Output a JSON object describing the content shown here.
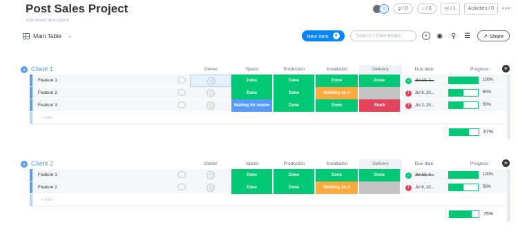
{
  "board": {
    "title": "Post Sales Project",
    "description_placeholder": "Add board description",
    "view_label": "Main Table"
  },
  "header": {
    "activity_counts": [
      "/ 0",
      "/ 0"
    ],
    "members": "/ 1",
    "activities_label": "Activities / 0"
  },
  "toolbar": {
    "new_item_label": "New Item",
    "search_placeholder": "Search / Filter Board",
    "share_label": "Share"
  },
  "columns": [
    "Owner",
    "Specs",
    "Production",
    "Installation",
    "Delivery",
    "Due date",
    "Progress"
  ],
  "groups": [
    {
      "name": "Client 1",
      "add_label": "+ Add",
      "summary_progress": "67%",
      "summary_fraction": 0.67,
      "rows": [
        {
          "name": "Feature 1",
          "owner_selected": true,
          "specs": "Done",
          "production": "Done",
          "installation": "Done",
          "delivery": "Done",
          "due": "Jul 13, 2...",
          "due_state": "ok",
          "progress": "100%",
          "progress_fraction": 1.0
        },
        {
          "name": "Feature 2",
          "owner_selected": false,
          "specs": "Done",
          "production": "Done",
          "installation": "Working on it",
          "delivery": "",
          "due": "Jul 6, 20...",
          "due_state": "warn",
          "progress": "50%",
          "progress_fraction": 0.5
        },
        {
          "name": "Feature 3",
          "owner_selected": false,
          "specs": "Waiting for review",
          "production": "Done",
          "installation": "Done",
          "delivery": "Stuck",
          "due": "Jul 2, 20...",
          "due_state": "warn",
          "progress": "50%",
          "progress_fraction": 0.5
        }
      ]
    },
    {
      "name": "Client 2",
      "add_label": "+ Add",
      "summary_progress": "75%",
      "summary_fraction": 0.75,
      "rows": [
        {
          "name": "Feature 1",
          "owner_selected": false,
          "specs": "Done",
          "production": "Done",
          "installation": "Done",
          "delivery": "Done",
          "due": "Jul 13, 2...",
          "due_state": "ok",
          "progress": "100%",
          "progress_fraction": 1.0
        },
        {
          "name": "Feature 2",
          "owner_selected": false,
          "specs": "Done",
          "production": "Done",
          "installation": "Working on it",
          "delivery": "",
          "due": "Jul 6, 20...",
          "due_state": "warn",
          "progress": "50%",
          "progress_fraction": 0.5
        }
      ]
    }
  ],
  "status_colors": {
    "Done": "#00c875",
    "Working on it": "#fdab3d",
    "Waiting for review": "#579bfc",
    "Stuck": "#e2445c",
    "": "#c4c4c4"
  },
  "group_color": "#579bfc"
}
